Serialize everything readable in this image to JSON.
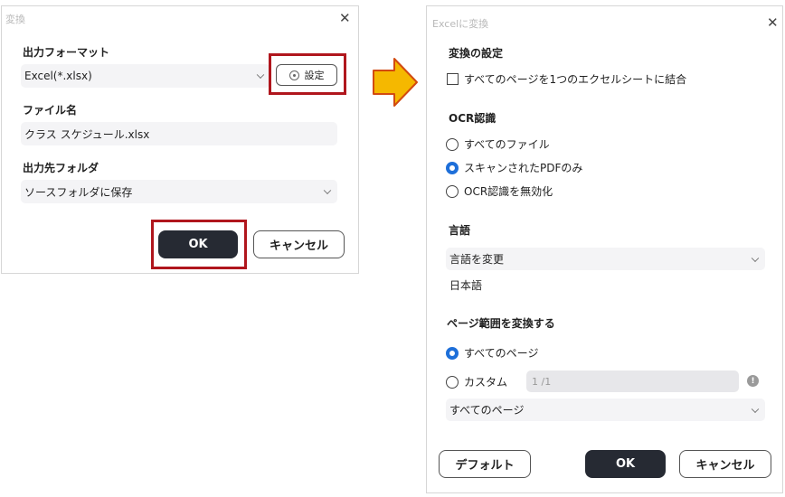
{
  "left_dialog": {
    "title": "変換",
    "format_label": "出力フォーマット",
    "format_value": "Excel(*.xlsx)",
    "settings_button": "設定",
    "filename_label": "ファイル名",
    "filename_value": "クラス スケジュール.xlsx",
    "folder_label": "出力先フォルダ",
    "folder_value": "ソースフォルダに保存",
    "ok_button": "OK",
    "cancel_button": "キャンセル"
  },
  "arrow": {
    "color": "#f5b800"
  },
  "right_dialog": {
    "title": "Excelに変換",
    "convert_settings_label": "変換の設定",
    "merge_checkbox_label": "すべてのページを1つのエクセルシートに結合",
    "merge_checked": false,
    "ocr_label": "OCR認識",
    "ocr_options": [
      "すべてのファイル",
      "スキャンされたPDFのみ",
      "OCR認識を無効化"
    ],
    "ocr_selected": 1,
    "language_label": "言語",
    "language_select": "言語を変更",
    "language_value": "日本語",
    "page_range_label": "ページ範囲を変換する",
    "page_all_option": "すべてのページ",
    "page_custom_option": "カスタム",
    "page_range_selected": 0,
    "custom_placeholder": "1 /1",
    "page_subset_select": "すべてのページ",
    "default_button": "デフォルト",
    "ok_button": "OK",
    "cancel_button": "キャンセル"
  },
  "colors": {
    "highlight": "#b0161d",
    "primary_button": "#262a33",
    "radio_selected": "#1e6fd9"
  }
}
